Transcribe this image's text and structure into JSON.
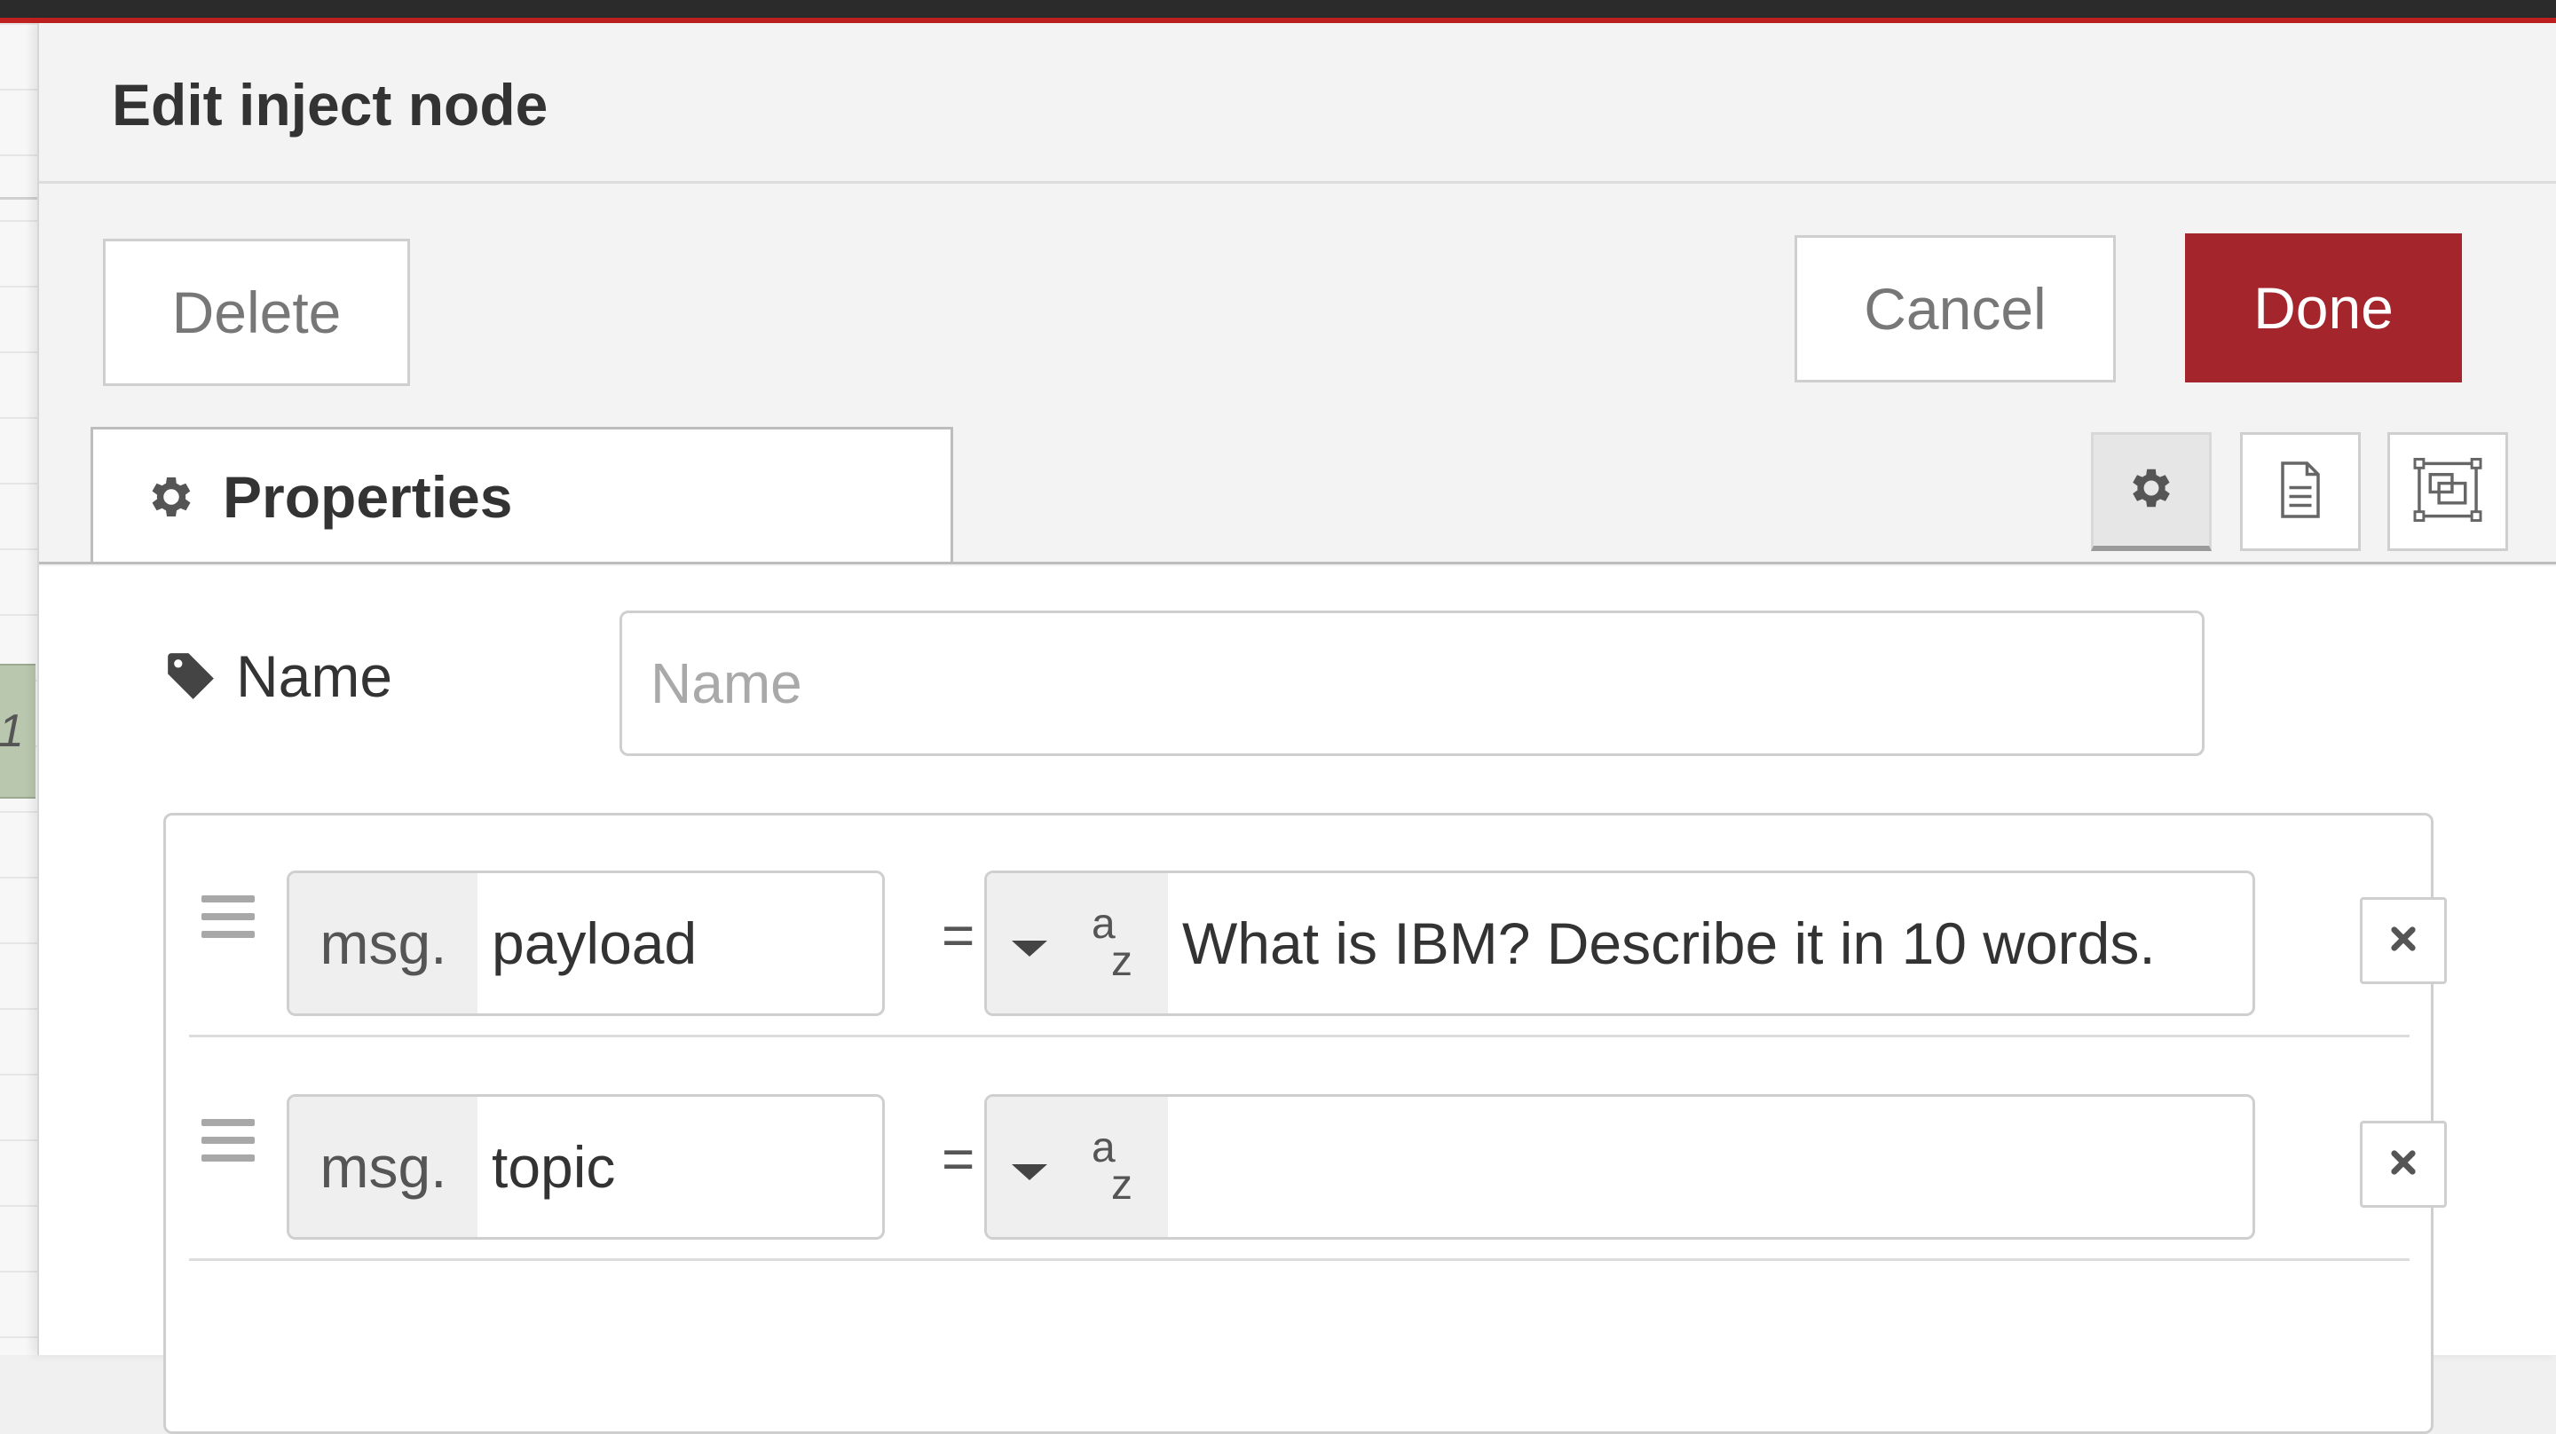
{
  "canvas": {
    "node_label": "1"
  },
  "tray": {
    "title": "Edit inject node",
    "buttons": {
      "delete": "Delete",
      "cancel": "Cancel",
      "done": "Done"
    },
    "tabs": {
      "properties": "Properties"
    },
    "side_icons": [
      "gear-icon",
      "description-icon",
      "appearance-icon"
    ]
  },
  "form": {
    "name_label": "Name",
    "name_placeholder": "Name",
    "name_value": "",
    "properties": [
      {
        "prefix": "msg.",
        "property": "payload",
        "operator": "=",
        "type_icon": "string-type-icon",
        "value": "What is IBM? Describe it in 10 words."
      },
      {
        "prefix": "msg.",
        "property": "topic",
        "operator": "=",
        "type_icon": "string-type-icon",
        "value": ""
      }
    ],
    "type_glyph": {
      "top": "a",
      "bottom": "z"
    }
  },
  "colors": {
    "done_button": "#a4262c",
    "header_red_line": "#c02020"
  }
}
